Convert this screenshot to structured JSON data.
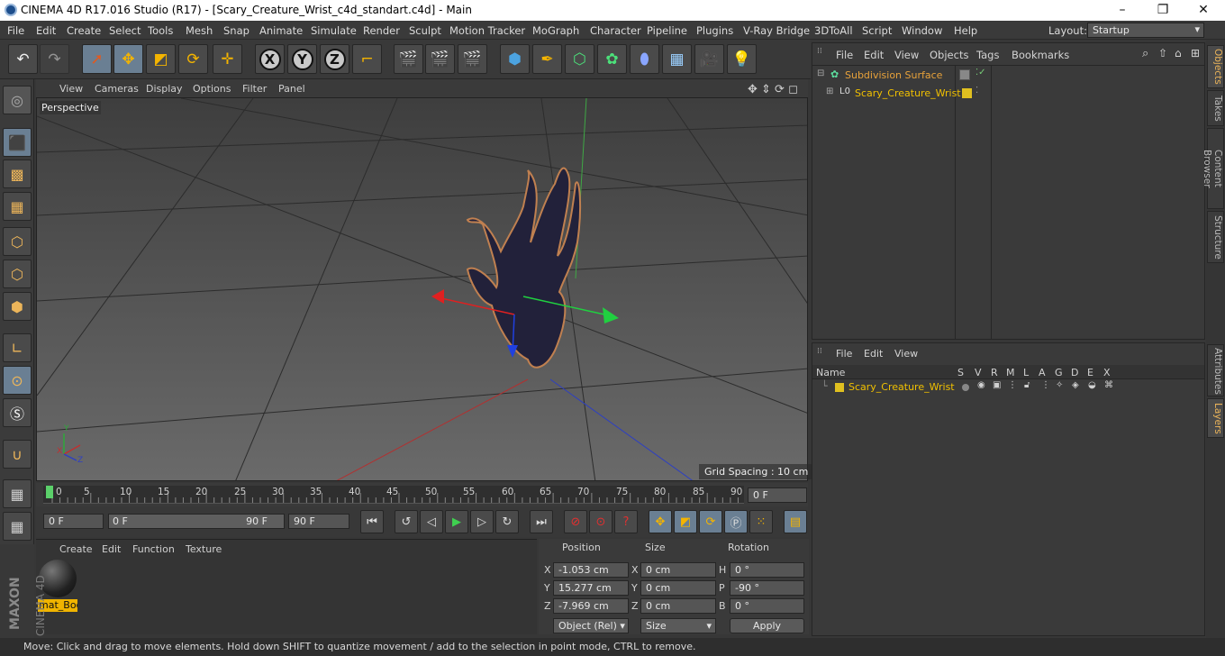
{
  "window": {
    "title": "CINEMA 4D R17.016 Studio (R17) - [Scary_Creature_Wrist_c4d_standart.c4d] - Main",
    "buttons": [
      "–",
      "❐",
      "✕"
    ]
  },
  "menubar": {
    "items": [
      "File",
      "Edit",
      "Create",
      "Select",
      "Tools",
      "Mesh",
      "Snap",
      "Animate",
      "Simulate",
      "Render",
      "Sculpt",
      "Motion Tracker",
      "MoGraph",
      "Character",
      "Pipeline",
      "Plugins",
      "V-Ray Bridge",
      "3DToAll",
      "Script",
      "Window",
      "Help"
    ],
    "layout_label": "Layout:",
    "layout_value": "Startup"
  },
  "toolbar": {
    "axis_x": "X",
    "axis_y": "Y",
    "axis_z": "Z"
  },
  "viewport": {
    "menu": [
      "View",
      "Cameras",
      "Display",
      "Options",
      "Filter",
      "Panel"
    ],
    "camera_label": "Perspective",
    "grid_spacing": "Grid Spacing : 10 cm",
    "axis_labels": [
      "Y",
      "X",
      "Z"
    ]
  },
  "timeline": {
    "ticks": [
      "0",
      "5",
      "10",
      "15",
      "20",
      "25",
      "30",
      "35",
      "40",
      "45",
      "50",
      "55",
      "60",
      "65",
      "70",
      "75",
      "80",
      "85",
      "90"
    ],
    "current_frame": "0 F",
    "start_frame": "0 F",
    "range_start": "0 F",
    "range_end": "90 F",
    "end_frame": "90 F"
  },
  "material_manager": {
    "menu": [
      "Create",
      "Edit",
      "Function",
      "Texture"
    ],
    "materials": [
      {
        "name": "mat_Bod"
      }
    ]
  },
  "coordinates": {
    "headers": [
      "Position",
      "Size",
      "Rotation"
    ],
    "rows": [
      {
        "axis": "X",
        "position": "-1.053 cm",
        "size_axis": "X",
        "size": "0 cm",
        "rot_axis": "H",
        "rotation": "0 °"
      },
      {
        "axis": "Y",
        "position": "15.277 cm",
        "size_axis": "Y",
        "size": "0 cm",
        "rot_axis": "P",
        "rotation": "-90 °"
      },
      {
        "axis": "Z",
        "position": "-7.969 cm",
        "size_axis": "Z",
        "size": "0 cm",
        "rot_axis": "B",
        "rotation": "0 °"
      }
    ],
    "mode_select": "Object (Rel)",
    "size_select": "Size",
    "apply_label": "Apply"
  },
  "object_manager": {
    "menu": [
      "File",
      "Edit",
      "View",
      "Objects",
      "Tags",
      "Bookmarks"
    ],
    "objects": [
      {
        "name": "Subdivision Surface",
        "color": "#e8a23a"
      },
      {
        "name": "Scary_Creature_Wrist",
        "color": "#f0c000"
      }
    ]
  },
  "layer_manager": {
    "menu": [
      "File",
      "Edit",
      "View"
    ],
    "columns": [
      "Name",
      "S",
      "V",
      "R",
      "M",
      "L",
      "A",
      "G",
      "D",
      "E",
      "X"
    ],
    "layers": [
      {
        "name": "Scary_Creature_Wrist",
        "color": "#e0c020"
      }
    ]
  },
  "side_tabs": {
    "top": [
      "Objects",
      "Takes",
      "Content Browser",
      "Structure"
    ],
    "bottom": [
      "Attributes",
      "Layers"
    ]
  },
  "branding": {
    "maxon": "MAXON",
    "c4d": "CINEMA 4D"
  },
  "status": "Move: Click and drag to move elements. Hold down SHIFT to quantize movement / add to the selection in point mode, CTRL to remove."
}
